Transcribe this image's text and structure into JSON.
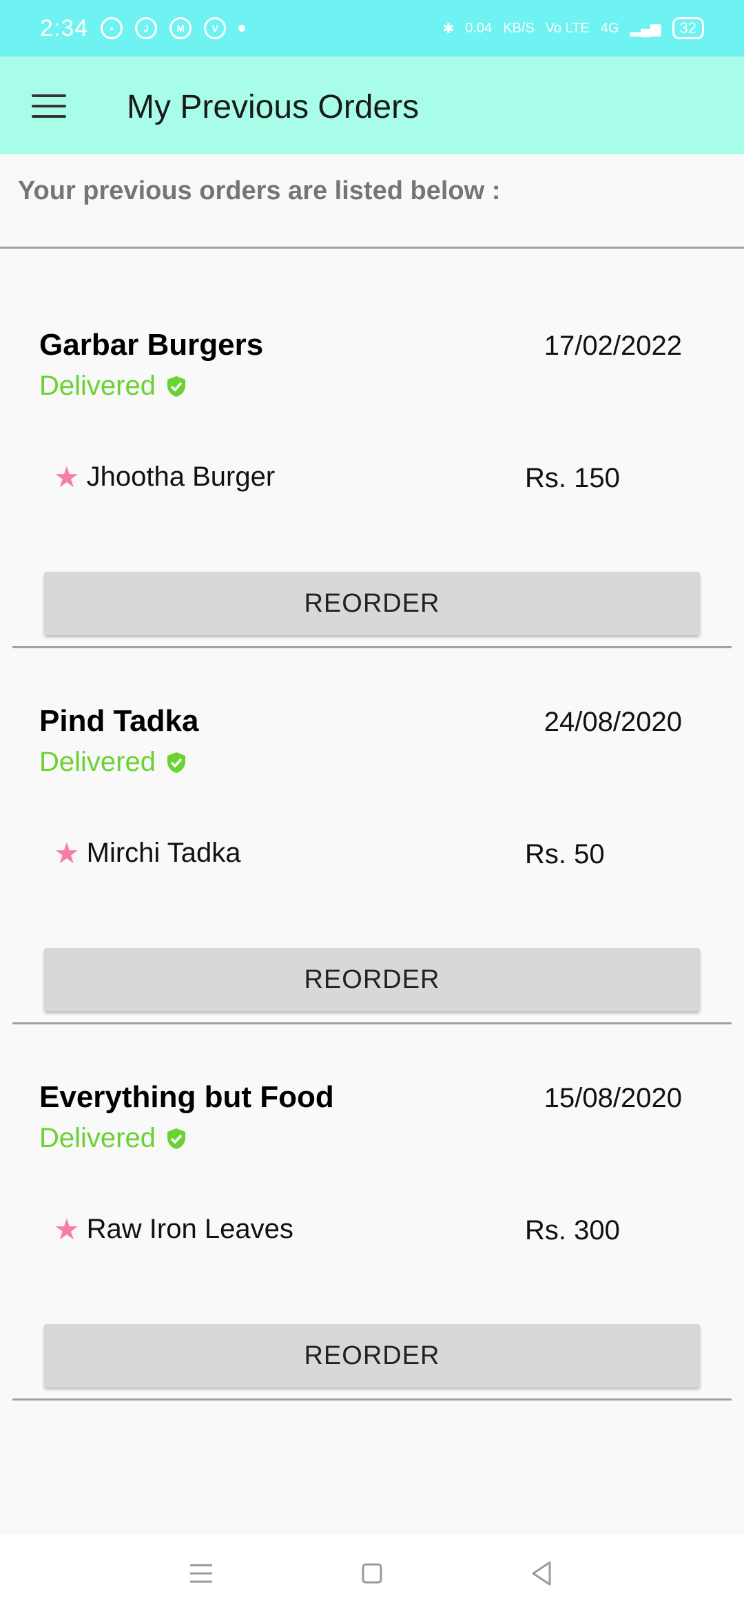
{
  "status_bar": {
    "time": "2:34",
    "net_speed": "0.04",
    "net_unit": "KB/S",
    "volte": "Vo LTE",
    "network": "4G",
    "battery": "32"
  },
  "app_bar": {
    "title": "My Previous Orders",
    "menu_icon": "hamburger-icon"
  },
  "subtitle": "Your previous orders are listed below :",
  "orders": [
    {
      "restaurant": "Garbar Burgers",
      "date": "17/02/2022",
      "status": "Delivered",
      "item": "Jhootha Burger",
      "price": "Rs. 150",
      "button": "REORDER"
    },
    {
      "restaurant": "Pind Tadka",
      "date": "24/08/2020",
      "status": "Delivered",
      "item": "Mirchi Tadka",
      "price": "Rs. 50",
      "button": "REORDER"
    },
    {
      "restaurant": "Everything but Food",
      "date": "15/08/2020",
      "status": "Delivered",
      "item": "Raw Iron Leaves",
      "price": "Rs. 300",
      "button": "REORDER"
    }
  ],
  "colors": {
    "status_bar": "#6ff2f2",
    "app_bar": "#a8fde9",
    "delivered": "#6ad233",
    "star": "#f47ea5",
    "button": "#d7d8d8"
  }
}
